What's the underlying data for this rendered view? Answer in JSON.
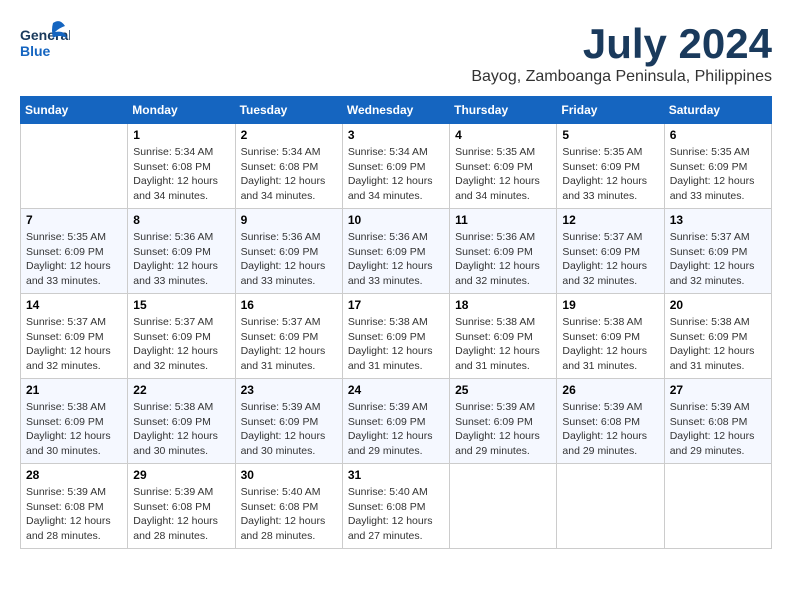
{
  "header": {
    "logo_line1": "General",
    "logo_line2": "Blue",
    "month": "July 2024",
    "location": "Bayog, Zamboanga Peninsula, Philippines"
  },
  "days_of_week": [
    "Sunday",
    "Monday",
    "Tuesday",
    "Wednesday",
    "Thursday",
    "Friday",
    "Saturday"
  ],
  "weeks": [
    [
      {
        "num": "",
        "info": ""
      },
      {
        "num": "1",
        "info": "Sunrise: 5:34 AM\nSunset: 6:08 PM\nDaylight: 12 hours\nand 34 minutes."
      },
      {
        "num": "2",
        "info": "Sunrise: 5:34 AM\nSunset: 6:08 PM\nDaylight: 12 hours\nand 34 minutes."
      },
      {
        "num": "3",
        "info": "Sunrise: 5:34 AM\nSunset: 6:09 PM\nDaylight: 12 hours\nand 34 minutes."
      },
      {
        "num": "4",
        "info": "Sunrise: 5:35 AM\nSunset: 6:09 PM\nDaylight: 12 hours\nand 34 minutes."
      },
      {
        "num": "5",
        "info": "Sunrise: 5:35 AM\nSunset: 6:09 PM\nDaylight: 12 hours\nand 33 minutes."
      },
      {
        "num": "6",
        "info": "Sunrise: 5:35 AM\nSunset: 6:09 PM\nDaylight: 12 hours\nand 33 minutes."
      }
    ],
    [
      {
        "num": "7",
        "info": "Sunrise: 5:35 AM\nSunset: 6:09 PM\nDaylight: 12 hours\nand 33 minutes."
      },
      {
        "num": "8",
        "info": "Sunrise: 5:36 AM\nSunset: 6:09 PM\nDaylight: 12 hours\nand 33 minutes."
      },
      {
        "num": "9",
        "info": "Sunrise: 5:36 AM\nSunset: 6:09 PM\nDaylight: 12 hours\nand 33 minutes."
      },
      {
        "num": "10",
        "info": "Sunrise: 5:36 AM\nSunset: 6:09 PM\nDaylight: 12 hours\nand 33 minutes."
      },
      {
        "num": "11",
        "info": "Sunrise: 5:36 AM\nSunset: 6:09 PM\nDaylight: 12 hours\nand 32 minutes."
      },
      {
        "num": "12",
        "info": "Sunrise: 5:37 AM\nSunset: 6:09 PM\nDaylight: 12 hours\nand 32 minutes."
      },
      {
        "num": "13",
        "info": "Sunrise: 5:37 AM\nSunset: 6:09 PM\nDaylight: 12 hours\nand 32 minutes."
      }
    ],
    [
      {
        "num": "14",
        "info": "Sunrise: 5:37 AM\nSunset: 6:09 PM\nDaylight: 12 hours\nand 32 minutes."
      },
      {
        "num": "15",
        "info": "Sunrise: 5:37 AM\nSunset: 6:09 PM\nDaylight: 12 hours\nand 32 minutes."
      },
      {
        "num": "16",
        "info": "Sunrise: 5:37 AM\nSunset: 6:09 PM\nDaylight: 12 hours\nand 31 minutes."
      },
      {
        "num": "17",
        "info": "Sunrise: 5:38 AM\nSunset: 6:09 PM\nDaylight: 12 hours\nand 31 minutes."
      },
      {
        "num": "18",
        "info": "Sunrise: 5:38 AM\nSunset: 6:09 PM\nDaylight: 12 hours\nand 31 minutes."
      },
      {
        "num": "19",
        "info": "Sunrise: 5:38 AM\nSunset: 6:09 PM\nDaylight: 12 hours\nand 31 minutes."
      },
      {
        "num": "20",
        "info": "Sunrise: 5:38 AM\nSunset: 6:09 PM\nDaylight: 12 hours\nand 31 minutes."
      }
    ],
    [
      {
        "num": "21",
        "info": "Sunrise: 5:38 AM\nSunset: 6:09 PM\nDaylight: 12 hours\nand 30 minutes."
      },
      {
        "num": "22",
        "info": "Sunrise: 5:38 AM\nSunset: 6:09 PM\nDaylight: 12 hours\nand 30 minutes."
      },
      {
        "num": "23",
        "info": "Sunrise: 5:39 AM\nSunset: 6:09 PM\nDaylight: 12 hours\nand 30 minutes."
      },
      {
        "num": "24",
        "info": "Sunrise: 5:39 AM\nSunset: 6:09 PM\nDaylight: 12 hours\nand 29 minutes."
      },
      {
        "num": "25",
        "info": "Sunrise: 5:39 AM\nSunset: 6:09 PM\nDaylight: 12 hours\nand 29 minutes."
      },
      {
        "num": "26",
        "info": "Sunrise: 5:39 AM\nSunset: 6:08 PM\nDaylight: 12 hours\nand 29 minutes."
      },
      {
        "num": "27",
        "info": "Sunrise: 5:39 AM\nSunset: 6:08 PM\nDaylight: 12 hours\nand 29 minutes."
      }
    ],
    [
      {
        "num": "28",
        "info": "Sunrise: 5:39 AM\nSunset: 6:08 PM\nDaylight: 12 hours\nand 28 minutes."
      },
      {
        "num": "29",
        "info": "Sunrise: 5:39 AM\nSunset: 6:08 PM\nDaylight: 12 hours\nand 28 minutes."
      },
      {
        "num": "30",
        "info": "Sunrise: 5:40 AM\nSunset: 6:08 PM\nDaylight: 12 hours\nand 28 minutes."
      },
      {
        "num": "31",
        "info": "Sunrise: 5:40 AM\nSunset: 6:08 PM\nDaylight: 12 hours\nand 27 minutes."
      },
      {
        "num": "",
        "info": ""
      },
      {
        "num": "",
        "info": ""
      },
      {
        "num": "",
        "info": ""
      }
    ]
  ]
}
